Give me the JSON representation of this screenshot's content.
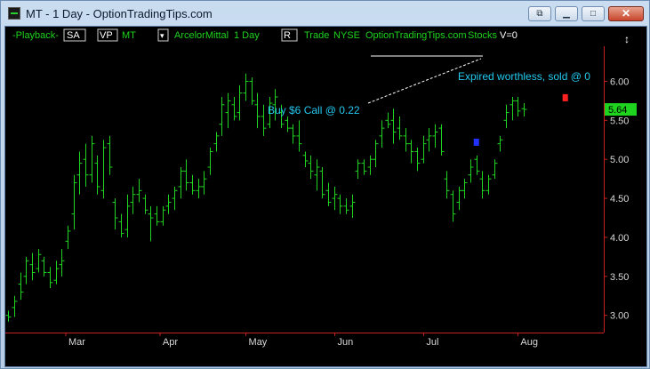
{
  "window": {
    "title": "MT - 1 Day - OptionTradingTips.com"
  },
  "toolbar": {
    "playback": "-Playback-",
    "sa": "SA",
    "vp": "VP",
    "symbol": "MT",
    "name": "ArcelorMittal",
    "interval": "1 Day",
    "r_button": "R",
    "trade": "Trade",
    "exchange": "NYSE",
    "brand": "OptionTradingTips.com",
    "stocks": "Stocks",
    "volume": "V=0"
  },
  "chart_data": {
    "type": "ohlc",
    "y_ticks": [
      3.0,
      3.5,
      4.0,
      4.5,
      5.0,
      5.5,
      6.0
    ],
    "y_tick_labels": [
      "3.00",
      "3.50",
      "4.00",
      "4.50",
      "5.00",
      "5.50",
      "6.00"
    ],
    "ylim": [
      2.78,
      6.45
    ],
    "last_price": "5.64",
    "months": [
      "Mar",
      "Apr",
      "May",
      "Jun",
      "Jul",
      "Aug"
    ],
    "month_positions": [
      10.2,
      26.1,
      40.6,
      55.6,
      70.6,
      86.5
    ],
    "x_range": [
      0,
      101
    ],
    "grid": false,
    "bars": [
      [
        3.0,
        2.92,
        3.06,
        2.98
      ],
      [
        3.1,
        2.98,
        3.25,
        3.18
      ],
      [
        3.4,
        3.2,
        3.55,
        3.3
      ],
      [
        3.5,
        3.4,
        3.75,
        3.7
      ],
      [
        3.65,
        3.45,
        3.8,
        3.55
      ],
      [
        3.6,
        3.55,
        3.85,
        3.78
      ],
      [
        3.7,
        3.5,
        3.75,
        3.55
      ],
      [
        3.55,
        3.35,
        3.62,
        3.42
      ],
      [
        3.45,
        3.4,
        3.7,
        3.6
      ],
      [
        3.65,
        3.5,
        3.85,
        3.7
      ],
      [
        3.95,
        3.85,
        4.15,
        4.08
      ],
      [
        4.3,
        4.1,
        4.8,
        4.7
      ],
      [
        4.8,
        4.55,
        5.1,
        4.95
      ],
      [
        5.0,
        4.65,
        5.2,
        4.8
      ],
      [
        4.8,
        4.7,
        5.3,
        5.2
      ],
      [
        4.95,
        4.55,
        5.05,
        4.65
      ],
      [
        4.6,
        4.5,
        5.25,
        5.15
      ],
      [
        5.2,
        4.8,
        5.3,
        4.9
      ],
      [
        4.45,
        4.1,
        4.5,
        4.25
      ],
      [
        4.2,
        4.0,
        4.3,
        4.05
      ],
      [
        4.1,
        4.0,
        4.55,
        4.4
      ],
      [
        4.45,
        4.3,
        4.65,
        4.55
      ],
      [
        4.55,
        4.45,
        4.75,
        4.6
      ],
      [
        4.5,
        4.3,
        4.55,
        4.35
      ],
      [
        4.3,
        3.95,
        4.4,
        4.25
      ],
      [
        4.3,
        4.15,
        4.4,
        4.2
      ],
      [
        4.2,
        4.15,
        4.4,
        4.35
      ],
      [
        4.4,
        4.3,
        4.55,
        4.45
      ],
      [
        4.5,
        4.35,
        4.65,
        4.6
      ],
      [
        4.65,
        4.5,
        4.9,
        4.85
      ],
      [
        4.85,
        4.6,
        5.0,
        4.7
      ],
      [
        4.7,
        4.55,
        4.8,
        4.6
      ],
      [
        4.6,
        4.5,
        4.75,
        4.65
      ],
      [
        4.65,
        4.55,
        4.85,
        4.75
      ],
      [
        4.9,
        4.8,
        5.15,
        5.1
      ],
      [
        5.2,
        5.1,
        5.35,
        5.3
      ],
      [
        5.45,
        5.3,
        5.8,
        5.7
      ],
      [
        5.6,
        5.4,
        5.85,
        5.75
      ],
      [
        5.7,
        5.5,
        5.8,
        5.55
      ],
      [
        5.6,
        5.5,
        5.95,
        5.85
      ],
      [
        5.85,
        5.75,
        6.1,
        6.0
      ],
      [
        6.0,
        5.7,
        6.05,
        5.75
      ],
      [
        5.7,
        5.4,
        5.85,
        5.55
      ],
      [
        5.55,
        5.3,
        5.7,
        5.4
      ],
      [
        5.45,
        5.4,
        5.8,
        5.72
      ],
      [
        5.7,
        5.5,
        5.9,
        5.8
      ],
      [
        5.6,
        5.4,
        5.7,
        5.45
      ],
      [
        5.5,
        5.35,
        5.55,
        5.4
      ],
      [
        5.4,
        5.2,
        5.45,
        5.3
      ],
      [
        5.3,
        5.1,
        5.5,
        5.2
      ],
      [
        5.05,
        4.9,
        5.1,
        4.98
      ],
      [
        4.95,
        4.75,
        5.05,
        4.85
      ],
      [
        4.8,
        4.6,
        5.0,
        4.9
      ],
      [
        4.85,
        4.5,
        4.9,
        4.55
      ],
      [
        4.6,
        4.4,
        4.7,
        4.45
      ],
      [
        4.5,
        4.35,
        4.65,
        4.55
      ],
      [
        4.5,
        4.3,
        4.55,
        4.4
      ],
      [
        4.4,
        4.3,
        4.5,
        4.35
      ],
      [
        4.4,
        4.25,
        4.55,
        4.45
      ],
      [
        4.85,
        4.75,
        5.0,
        4.95
      ],
      [
        4.95,
        4.8,
        5.0,
        4.85
      ],
      [
        4.9,
        4.8,
        5.05,
        5.0
      ],
      [
        5.0,
        4.9,
        5.25,
        5.2
      ],
      [
        5.3,
        5.15,
        5.5,
        5.4
      ],
      [
        5.5,
        5.4,
        5.6,
        5.45
      ],
      [
        5.5,
        5.2,
        5.65,
        5.35
      ],
      [
        5.4,
        5.25,
        5.55,
        5.3
      ],
      [
        5.3,
        5.1,
        5.4,
        5.2
      ],
      [
        5.2,
        4.95,
        5.25,
        5.1
      ],
      [
        5.1,
        4.85,
        5.15,
        4.95
      ],
      [
        5.0,
        4.95,
        5.3,
        5.2
      ],
      [
        5.25,
        5.1,
        5.4,
        5.3
      ],
      [
        5.3,
        5.15,
        5.45,
        5.35
      ],
      [
        5.4,
        5.05,
        5.45,
        5.1
      ],
      [
        4.75,
        4.5,
        4.85,
        4.6
      ],
      [
        4.55,
        4.2,
        4.6,
        4.3
      ],
      [
        4.45,
        4.35,
        4.65,
        4.6
      ],
      [
        4.6,
        4.5,
        4.75,
        4.7
      ],
      [
        4.8,
        4.7,
        5.0,
        4.9
      ],
      [
        5.0,
        4.8,
        5.05,
        4.85
      ],
      [
        4.75,
        4.5,
        4.85,
        4.6
      ],
      [
        4.6,
        4.55,
        4.8,
        4.75
      ],
      [
        4.8,
        4.75,
        5.0,
        4.95
      ],
      [
        5.2,
        5.1,
        5.3,
        5.25
      ],
      [
        5.5,
        5.4,
        5.7,
        5.6
      ],
      [
        5.7,
        5.5,
        5.8,
        5.75
      ],
      [
        5.75,
        5.55,
        5.8,
        5.62
      ],
      [
        5.65,
        5.55,
        5.72,
        5.64
      ]
    ]
  },
  "annotations": {
    "buy": "Buy $6 Call @ 0.22",
    "expired": "Expired worthless, sold @ 0"
  },
  "colors": {
    "background": "#000000",
    "bars": "#1ed41e",
    "axis": "#c82020",
    "annotation": "#23c9ef",
    "buy_marker": "#2030ff",
    "sell_marker": "#ff2020"
  }
}
